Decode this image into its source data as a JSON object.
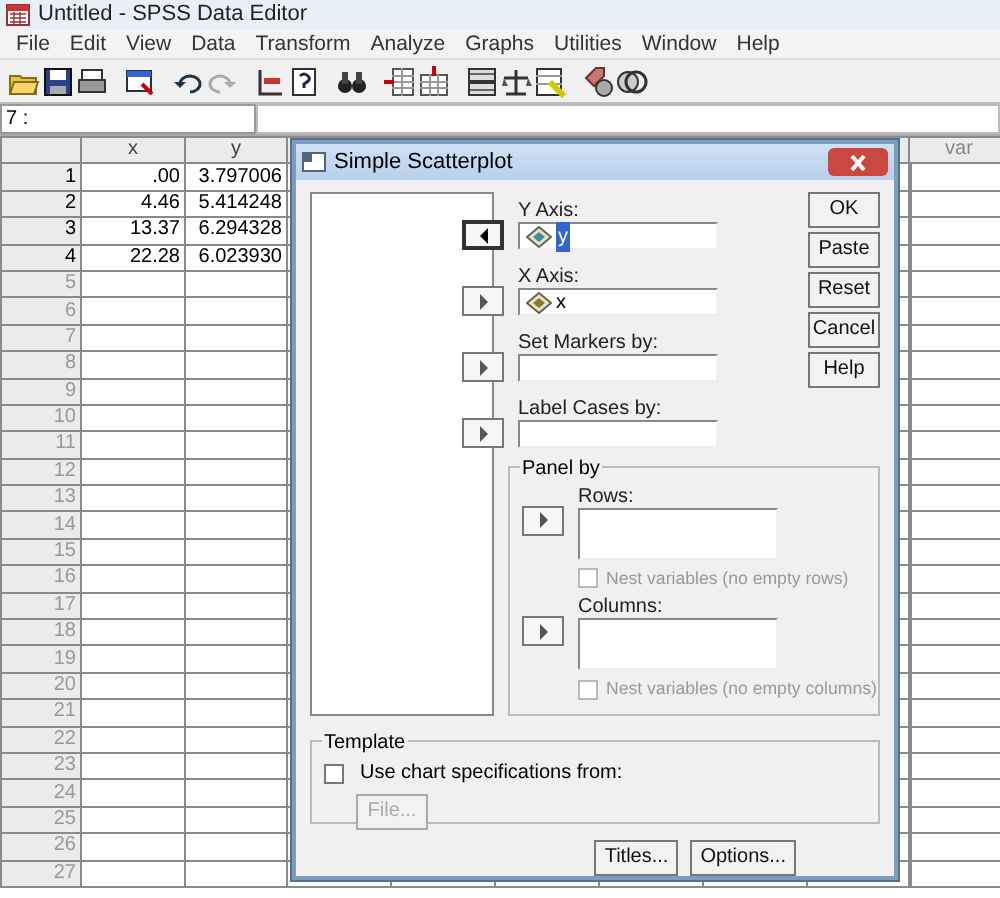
{
  "window": {
    "title": "Untitled - SPSS Data Editor"
  },
  "menu": [
    "File",
    "Edit",
    "View",
    "Data",
    "Transform",
    "Analyze",
    "Graphs",
    "Utilities",
    "Window",
    "Help"
  ],
  "cell_editor": {
    "reference": "7 :"
  },
  "grid": {
    "columns": [
      "x",
      "y",
      "var"
    ],
    "rows": [
      {
        "number": "1",
        "has_data": true,
        "cells": [
          ".00",
          "3.797006"
        ]
      },
      {
        "number": "2",
        "has_data": true,
        "cells": [
          "4.46",
          "5.414248"
        ]
      },
      {
        "number": "3",
        "has_data": true,
        "cells": [
          "13.37",
          "6.294328"
        ]
      },
      {
        "number": "4",
        "has_data": true,
        "cells": [
          "22.28",
          "6.023930"
        ]
      },
      {
        "number": "5",
        "has_data": false
      },
      {
        "number": "6",
        "has_data": false
      },
      {
        "number": "7",
        "has_data": false
      },
      {
        "number": "8",
        "has_data": false
      },
      {
        "number": "9",
        "has_data": false
      },
      {
        "number": "10",
        "has_data": false
      },
      {
        "number": "11",
        "has_data": false
      },
      {
        "number": "12",
        "has_data": false
      },
      {
        "number": "13",
        "has_data": false
      },
      {
        "number": "14",
        "has_data": false
      },
      {
        "number": "15",
        "has_data": false
      },
      {
        "number": "16",
        "has_data": false
      },
      {
        "number": "17",
        "has_data": false
      },
      {
        "number": "18",
        "has_data": false
      },
      {
        "number": "19",
        "has_data": false
      },
      {
        "number": "20",
        "has_data": false
      },
      {
        "number": "21",
        "has_data": false
      },
      {
        "number": "22",
        "has_data": false
      },
      {
        "number": "23",
        "has_data": false
      },
      {
        "number": "24",
        "has_data": false
      },
      {
        "number": "25",
        "has_data": false
      },
      {
        "number": "26",
        "has_data": false
      },
      {
        "number": "27",
        "has_data": false
      }
    ]
  },
  "dialog": {
    "title": "Simple Scatterplot",
    "targets": [
      {
        "label": "Y Axis:",
        "kind": "remove",
        "value": "y",
        "selected": true
      },
      {
        "label": "X Axis:",
        "kind": "add",
        "value": "x",
        "selected": false
      },
      {
        "label": "Set Markers by:",
        "kind": "add"
      },
      {
        "label": "Label Cases by:",
        "kind": "add"
      }
    ],
    "buttons": [
      "OK",
      "Paste",
      "Reset",
      "Cancel",
      "Help"
    ],
    "panel_by": {
      "legend": "Panel by",
      "groups": [
        {
          "label": "Rows:",
          "nest": {
            "label": "Nest variables (no empty rows)",
            "checked": false,
            "disabled": true
          }
        },
        {
          "label": "Columns:",
          "nest": {
            "label": "Nest variables (no empty columns)",
            "checked": false,
            "disabled": true
          }
        }
      ]
    },
    "template": {
      "legend": "Template",
      "checkbox": {
        "label": "Use chart specifications from:",
        "checked": false
      },
      "file_button": {
        "label": "File...",
        "disabled": true
      }
    },
    "bottom_buttons": [
      "Titles...",
      "Options..."
    ]
  }
}
